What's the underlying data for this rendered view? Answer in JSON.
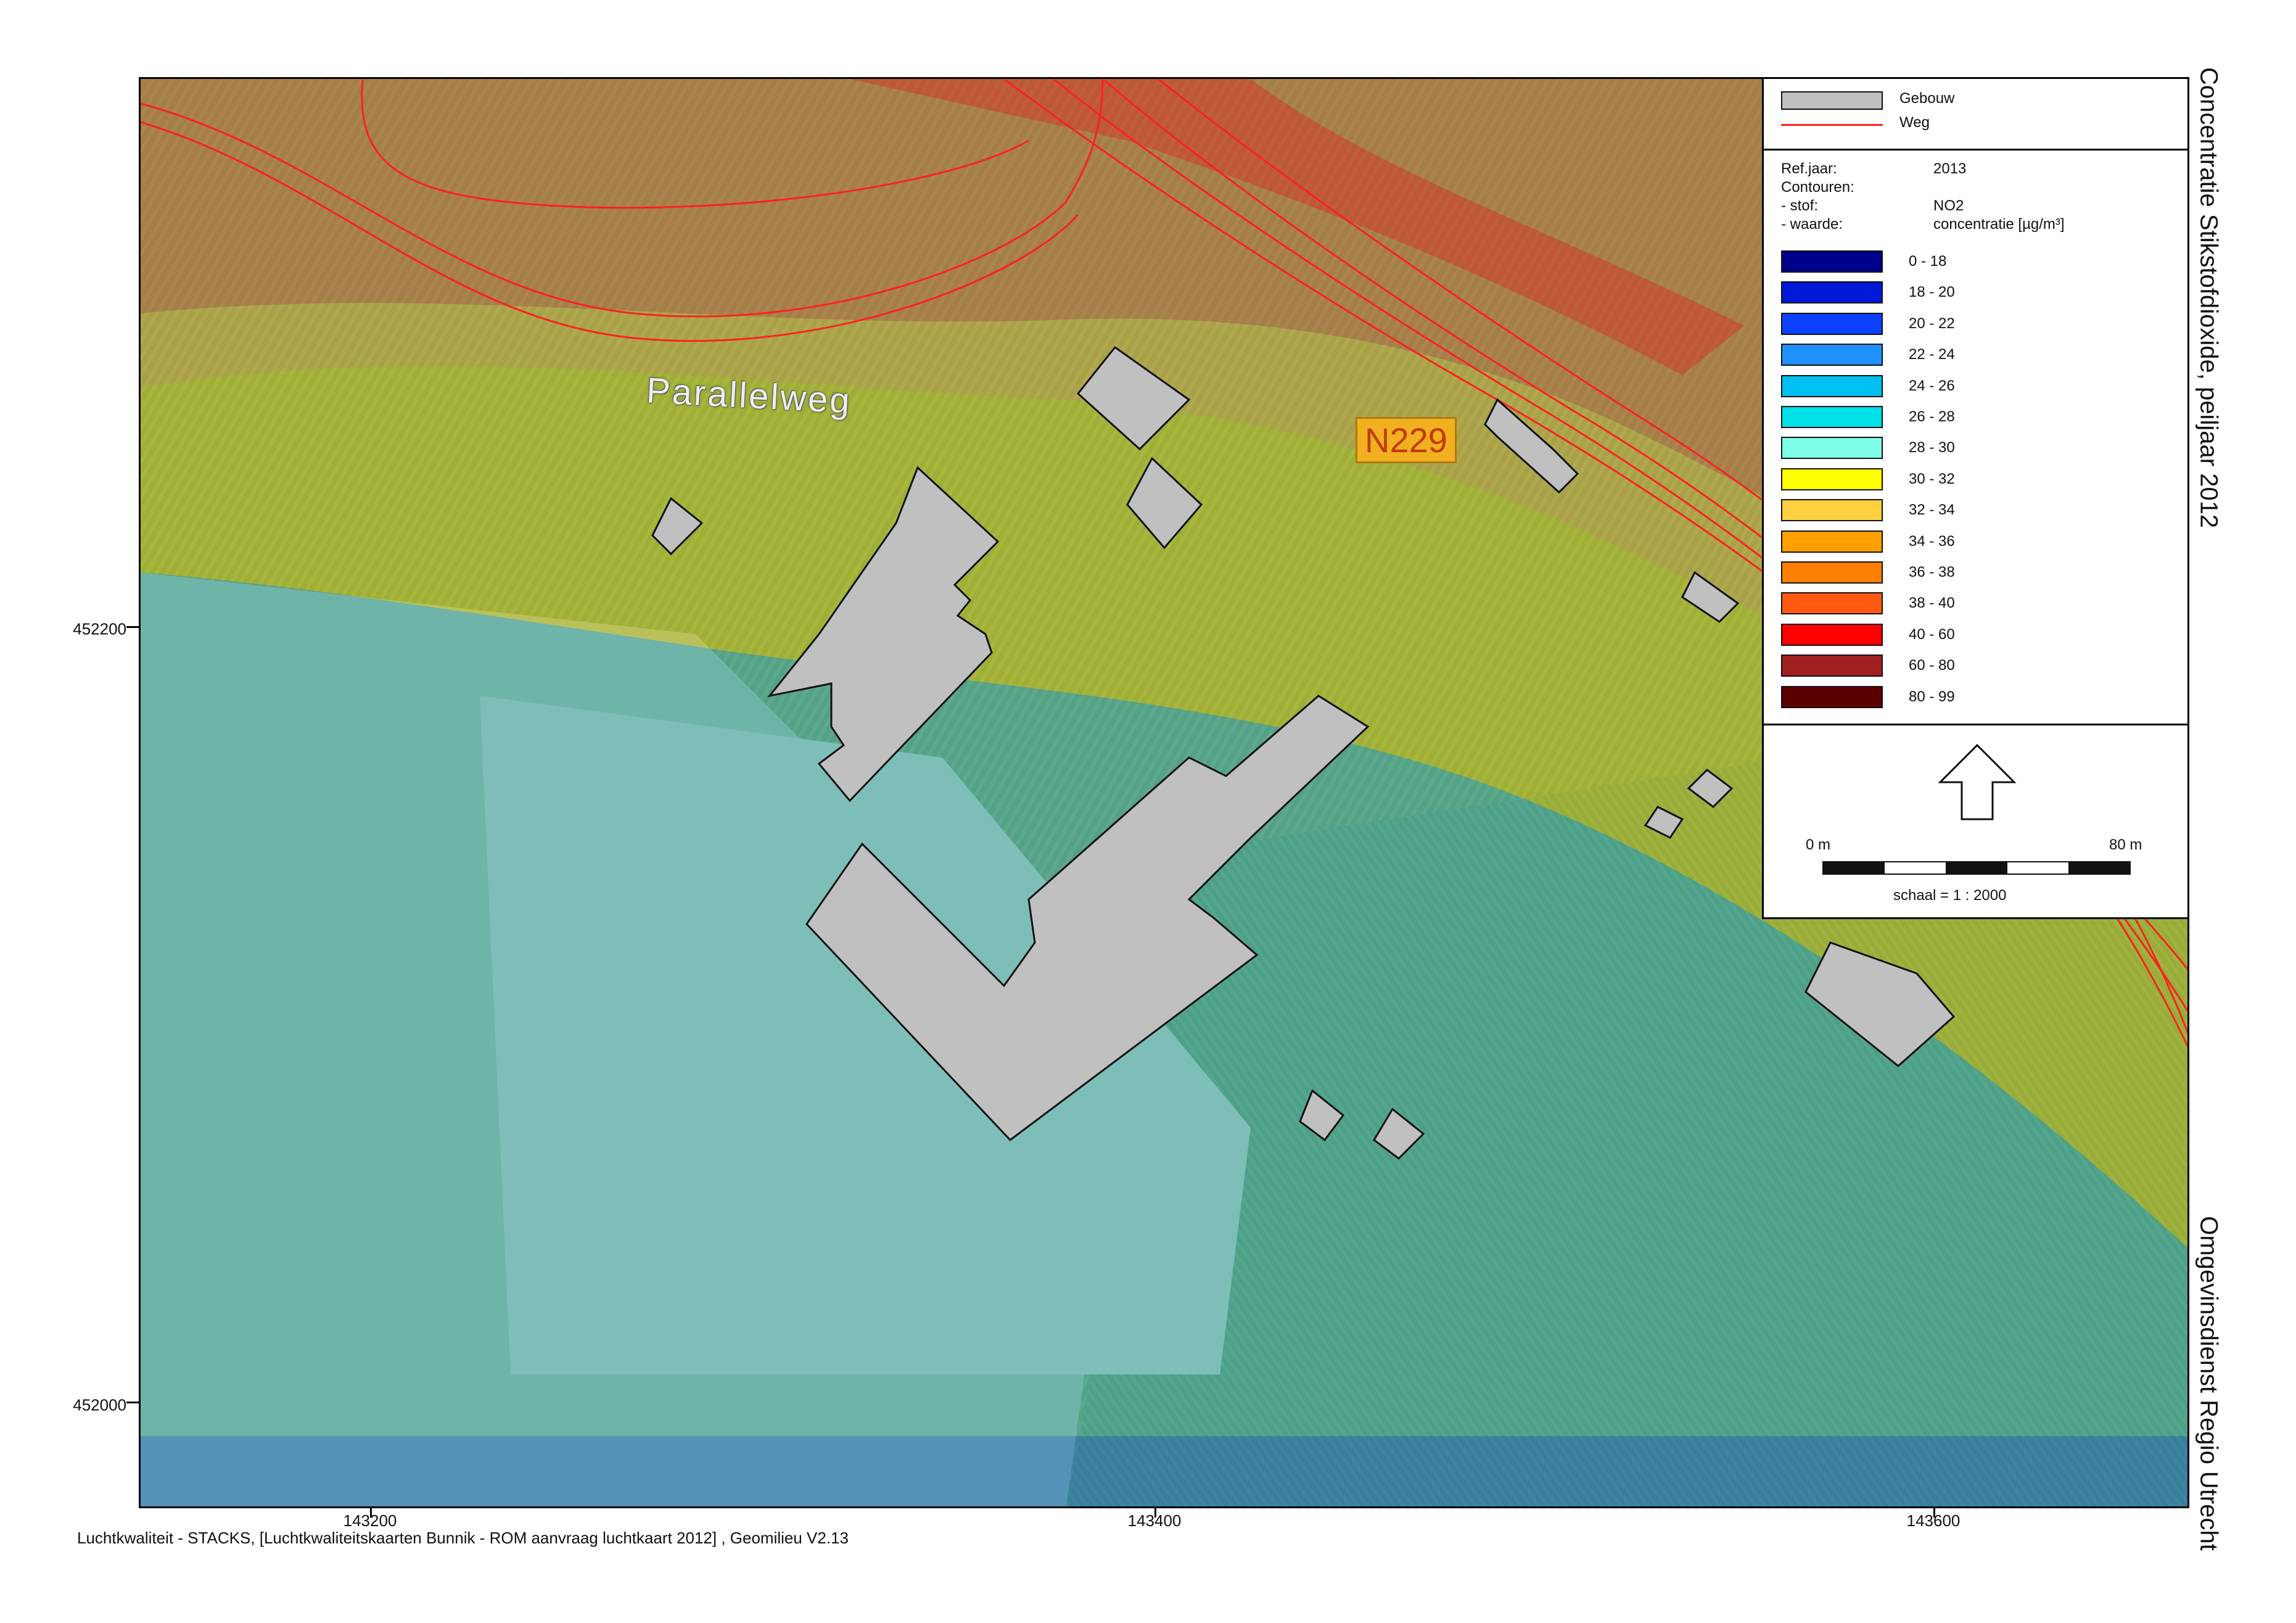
{
  "map": {
    "title": "Concentratie Stikstofdioxide, peiljaar 2012",
    "organisation": "Omgevinsdienst Regio Utrecht",
    "footer": "Luchtkwaliteit - STACKS, [Luchtkwaliteitskaarten Bunnik - ROM aanvraag luchtkaart 2012] , Geomilieu V2.13",
    "street_label": "Parallelweg",
    "road_label": "N229",
    "y_ticks": [
      "452200",
      "452000"
    ],
    "x_ticks": [
      "143200",
      "143400",
      "143600"
    ]
  },
  "legend": {
    "building_label": "Gebouw",
    "road_label": "Weg",
    "refjaar_label": "Ref.jaar:",
    "refjaar_value": "2013",
    "contouren_label": "Contouren:",
    "stof_label": "- stof:",
    "stof_value": "NO2",
    "waarde_label": "- waarde:",
    "waarde_value": "concentratie [µg/m³]",
    "classes": [
      {
        "label": "0 - 18",
        "color": "#00008b"
      },
      {
        "label": "18 - 20",
        "color": "#0018d8"
      },
      {
        "label": "20 - 22",
        "color": "#0a40ff"
      },
      {
        "label": "22 - 24",
        "color": "#1e90ff"
      },
      {
        "label": "24 - 26",
        "color": "#00c0f0"
      },
      {
        "label": "26 - 28",
        "color": "#00e0e8"
      },
      {
        "label": "28 - 30",
        "color": "#80ffe8"
      },
      {
        "label": "30 - 32",
        "color": "#ffff00"
      },
      {
        "label": "32 - 34",
        "color": "#ffd040"
      },
      {
        "label": "34 - 36",
        "color": "#ffa000"
      },
      {
        "label": "36 - 38",
        "color": "#ff8000"
      },
      {
        "label": "38 - 40",
        "color": "#ff5a10"
      },
      {
        "label": "40 - 60",
        "color": "#ff0000"
      },
      {
        "label": "60 - 80",
        "color": "#a02020"
      },
      {
        "label": "80 - 99",
        "color": "#5a0000"
      }
    ],
    "north_arrow_icon": "north-arrow-icon",
    "scale_start": "0 m",
    "scale_end": "80 m",
    "scale_text": "schaal = 1 : 2000"
  }
}
